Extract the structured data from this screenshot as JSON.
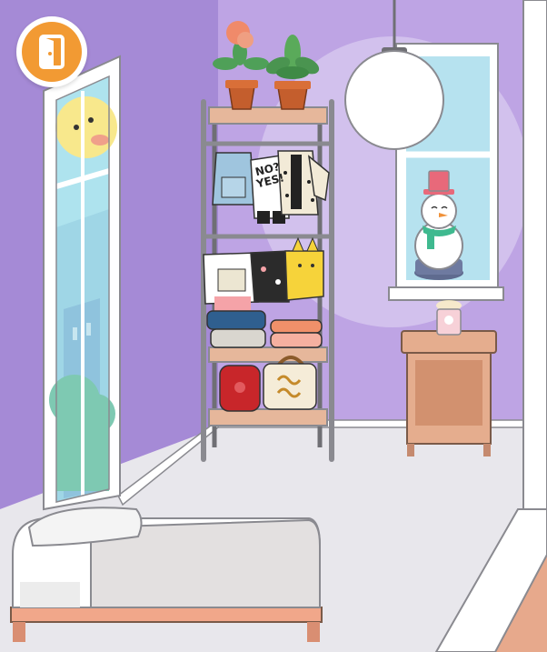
{
  "scene": {
    "exit_button": {
      "icon": "exit-door-icon"
    },
    "shirt_print": {
      "line1": "NO?",
      "line2": "YES!"
    }
  },
  "colors": {
    "wall": "#b79be0",
    "floor": "#e8e7ec",
    "accent_orange": "#f29a33",
    "shelf_wood": "#e6b79b",
    "frame": "#6f6f74"
  }
}
